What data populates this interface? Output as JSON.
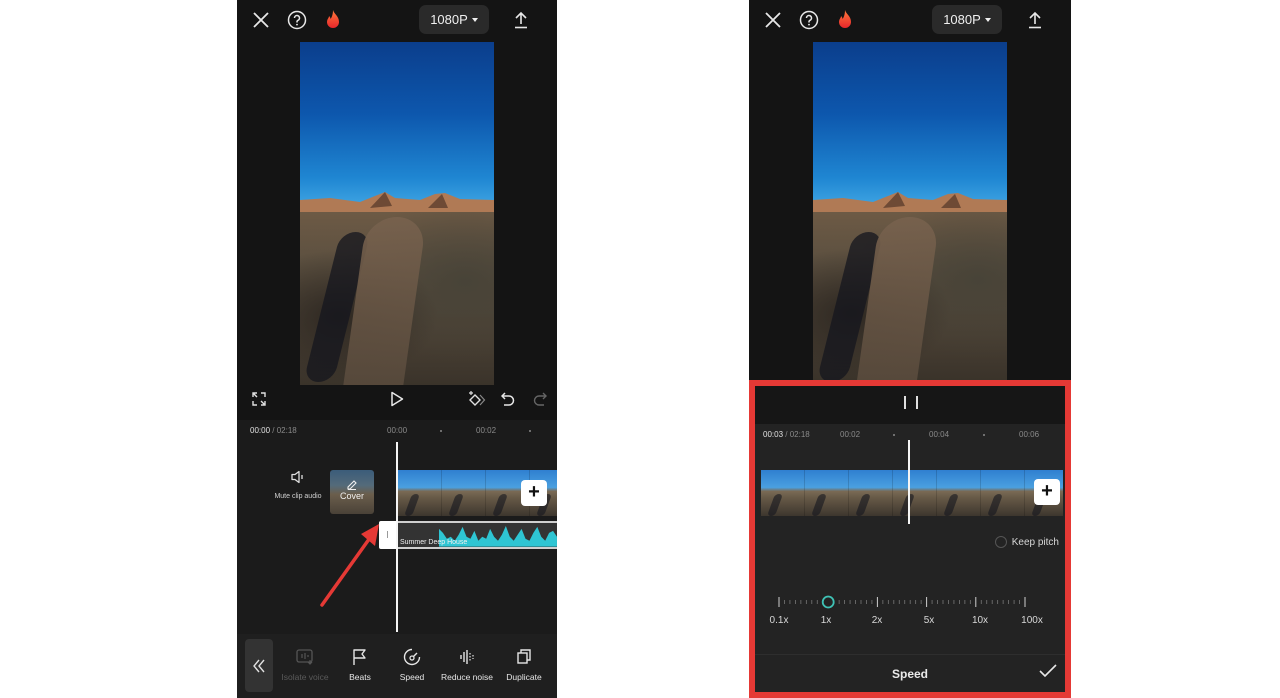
{
  "colors": {
    "accent_teal": "#2ec5d3",
    "slider_knob": "#3fc2b5",
    "highlight_red": "#e53935",
    "fire": "#ff4d2e"
  },
  "left_screen": {
    "topbar": {
      "close_icon": "close-icon",
      "help_icon": "help-icon",
      "fire_icon": "fire-icon",
      "resolution": "1080P",
      "export_icon": "export-icon"
    },
    "controls": {
      "fullscreen_icon": "fullscreen-icon",
      "play_icon": "play-icon",
      "keyframe_icon": "keyframe-icon",
      "undo_icon": "undo-icon",
      "redo_icon": "redo-icon"
    },
    "timeline": {
      "current_time": "00:00",
      "total_time": " / 02:18",
      "ticks": [
        "00:00",
        "00:02"
      ]
    },
    "mute_label": "Mute clip audio",
    "cover_label": "Cover",
    "audio_track_label": "Summer Deep House",
    "toolbar": [
      {
        "label": "Isolate voice",
        "icon": "isolate-voice-icon",
        "disabled": true
      },
      {
        "label": "Beats",
        "icon": "beats-flag-icon"
      },
      {
        "label": "Speed",
        "icon": "speed-gauge-icon"
      },
      {
        "label": "Reduce noise",
        "icon": "reduce-noise-icon"
      },
      {
        "label": "Duplicate",
        "icon": "duplicate-icon"
      }
    ]
  },
  "right_screen": {
    "topbar": {
      "resolution": "1080P"
    },
    "timeline": {
      "current_time": "00:03",
      "total_time": " / 02:18",
      "ticks": [
        "00:02",
        "00:04",
        "00:06"
      ]
    },
    "keep_pitch_label": "Keep pitch",
    "keep_pitch_checked": false,
    "speed_options": [
      "0.1x",
      "1x",
      "2x",
      "5x",
      "10x",
      "100x"
    ],
    "speed_selected": "1x",
    "panel_title": "Speed"
  }
}
